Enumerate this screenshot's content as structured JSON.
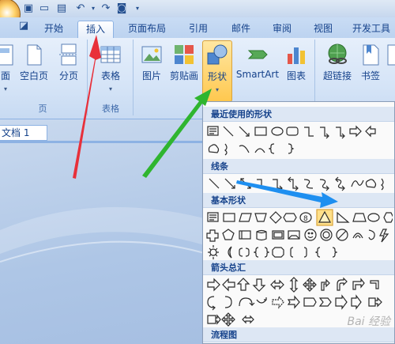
{
  "tabs": {
    "home": "开始",
    "insert": "插入",
    "layout": "页面布局",
    "references": "引用",
    "mailings": "邮件",
    "review": "审阅",
    "view": "视图",
    "developer": "开发工具"
  },
  "ribbon": {
    "pages_group": {
      "cover_label": "面",
      "blank_page": "空白页",
      "page_break": "分页",
      "label": "页"
    },
    "tables_group": {
      "table": "表格",
      "label": "表格"
    },
    "illustrations_group": {
      "picture": "图片",
      "clipart": "剪贴画",
      "shapes": "形状",
      "smartart": "SmartArt",
      "chart": "图表"
    },
    "links_group": {
      "hyperlink": "超链接",
      "bookmark": "书签"
    }
  },
  "document": {
    "tab_label": "文档 1"
  },
  "shapes_menu": {
    "recent": "最近使用的形状",
    "lines": "线条",
    "basic": "基本形状",
    "arrows": "箭头总汇",
    "flowchart": "流程图"
  },
  "watermark": "Bai 经验",
  "colors": {
    "annotation_red": "#e8303a",
    "annotation_green": "#2fb52f",
    "annotation_blue": "#1e8ff0",
    "active_button": "#ffc84f"
  }
}
